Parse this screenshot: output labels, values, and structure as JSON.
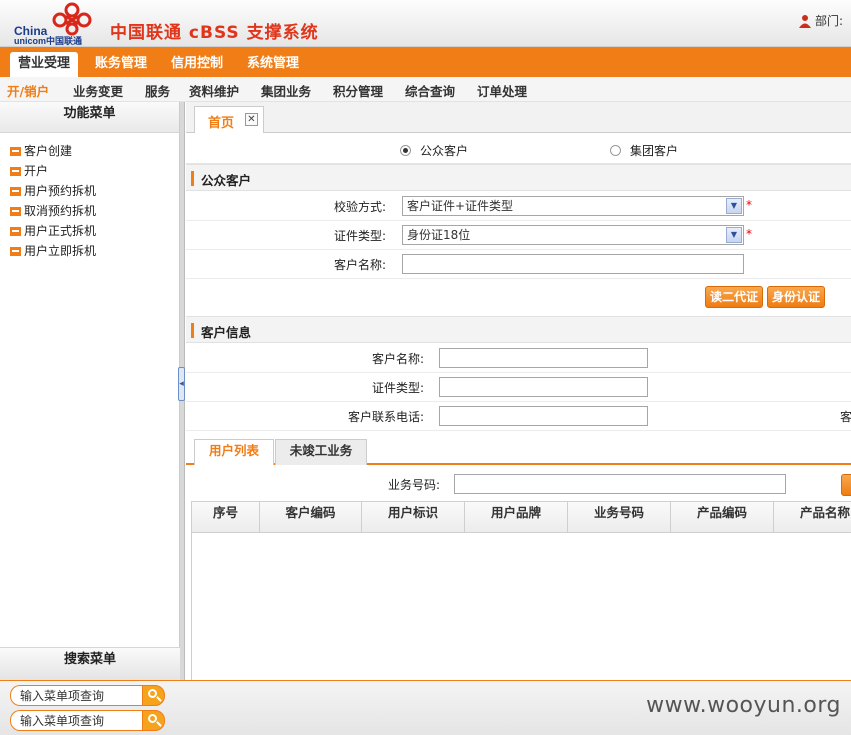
{
  "header": {
    "logo_line1": "China",
    "logo_line2": "unicom中国联通",
    "system_title": "中国联通 cBSS 支撑系统",
    "dept_label": "部门:"
  },
  "main_menu": [
    {
      "label": "营业受理",
      "active": true
    },
    {
      "label": "账务管理",
      "active": false
    },
    {
      "label": "信用控制",
      "active": false
    },
    {
      "label": "系统管理",
      "active": false
    }
  ],
  "sub_menu": [
    {
      "label": "开/销户",
      "active": true
    },
    {
      "label": "业务变更",
      "active": false
    },
    {
      "label": "服务",
      "active": false
    },
    {
      "label": "资料维护",
      "active": false
    },
    {
      "label": "集团业务",
      "active": false
    },
    {
      "label": "积分管理",
      "active": false
    },
    {
      "label": "综合查询",
      "active": false
    },
    {
      "label": "订单处理",
      "active": false
    }
  ],
  "sidebar": {
    "title": "功能菜单",
    "items": [
      {
        "label": "客户创建"
      },
      {
        "label": "开户"
      },
      {
        "label": "用户预约拆机"
      },
      {
        "label": "取消预约拆机"
      },
      {
        "label": "用户正式拆机"
      },
      {
        "label": "用户立即拆机"
      }
    ],
    "search_title": "搜索菜单"
  },
  "bottom": {
    "search_placeholder_1": "输入菜单项查询",
    "search_placeholder_2": "输入菜单项查询",
    "watermark": "www.wooyun.org"
  },
  "content": {
    "tab_home": "首页",
    "tab_close": "✕",
    "customer_type": {
      "option_public": "公众客户",
      "option_group": "集团客户",
      "selected": "公众客户"
    },
    "public_section": {
      "title": "公众客户",
      "verify_label": "校验方式:",
      "verify_value": "客户证件+证件类型",
      "idtype_label": "证件类型:",
      "idtype_value": "身份证18位",
      "name_label": "客户名称:",
      "name_value": "",
      "required_mark": "*"
    },
    "buttons": {
      "read_id": "读二代证",
      "id_auth": "身份认证"
    },
    "info_section": {
      "title": "客户信息",
      "name_label": "客户名称:",
      "idtype_label": "证件类型:",
      "phone_label": "客户联系电话:",
      "cut_label": "客"
    },
    "subtabs": [
      {
        "label": "用户列表",
        "active": true
      },
      {
        "label": "未竣工业务",
        "active": false
      }
    ],
    "service_number_label": "业务号码:",
    "grid_columns": [
      "序号",
      "客户编码",
      "用户标识",
      "用户品牌",
      "业务号码",
      "产品编码",
      "产品名称"
    ]
  }
}
